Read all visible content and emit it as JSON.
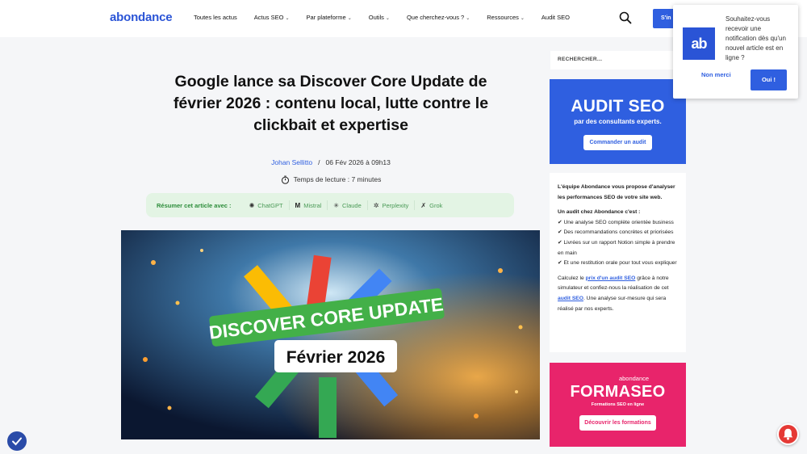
{
  "header": {
    "logo": "abondance",
    "nav": [
      {
        "label": "Toutes les actus",
        "dropdown": false
      },
      {
        "label": "Actus SEO",
        "dropdown": true
      },
      {
        "label": "Par plateforme",
        "dropdown": true
      },
      {
        "label": "Outils",
        "dropdown": true
      },
      {
        "label": "Que cherchez-vous ?",
        "dropdown": true
      },
      {
        "label": "Ressources",
        "dropdown": true
      },
      {
        "label": "Audit SEO",
        "dropdown": false
      }
    ],
    "signin_label": "S'in"
  },
  "article": {
    "title": "Google lance sa Discover Core Update de février 2026 : contenu local, lutte contre le clickbait et expertise",
    "author": "Johan Sellitto",
    "date": "06 Fév 2026 à 09h13",
    "reading_time": "Temps de lecture : 7 minutes",
    "summary_label": "Résumer cet article avec :",
    "ai_tools": [
      {
        "label": "ChatGPT",
        "icon": "✺"
      },
      {
        "label": "Mistral",
        "icon": "M"
      },
      {
        "label": "Claude",
        "icon": "✳"
      },
      {
        "label": "Perplexity",
        "icon": "✲"
      },
      {
        "label": "Grok",
        "icon": "✗"
      }
    ],
    "hero": {
      "banner_text": "DISCOVER CORE UPDATE",
      "date_text": "Février 2026"
    }
  },
  "sidebar": {
    "search_placeholder": "RECHERCHER...",
    "audit": {
      "title": "AUDIT SEO",
      "subtitle": "par des consultants experts.",
      "button": "Commander un audit"
    },
    "info": {
      "intro": "L'équipe Abondance vous propose d'analyser les performances SEO de votre site web.",
      "heading": "Un audit chez Abondance c'est :",
      "items": [
        "✔ Une analyse SEO complète orientée business",
        "✔ Des recommandations concrètes et priorisées",
        "✔ Livrées sur un rapport Notion simple à prendre en main",
        "✔ Et une restitution orale pour tout vous expliquer"
      ],
      "calc_pre": "Calculez le ",
      "calc_link": "prix d'un audit SEO",
      "calc_mid": " grâce à notre simulateur et confiez-nous la réalisation de cet ",
      "calc_link2": "audit SEO",
      "calc_post": ". Une analyse sur-mesure qui sera réalisé par nos experts."
    },
    "formation": {
      "brand": "abondance",
      "title": "FORMASEO",
      "subtitle": "Formations SEO en ligne",
      "button": "Découvrir les formations"
    }
  },
  "notification": {
    "logo": "ab",
    "message": "Souhaitez-vous recevoir une notification dès qu'un nouvel article est en ligne ?",
    "decline": "Non merci",
    "accept": "Oui !"
  }
}
